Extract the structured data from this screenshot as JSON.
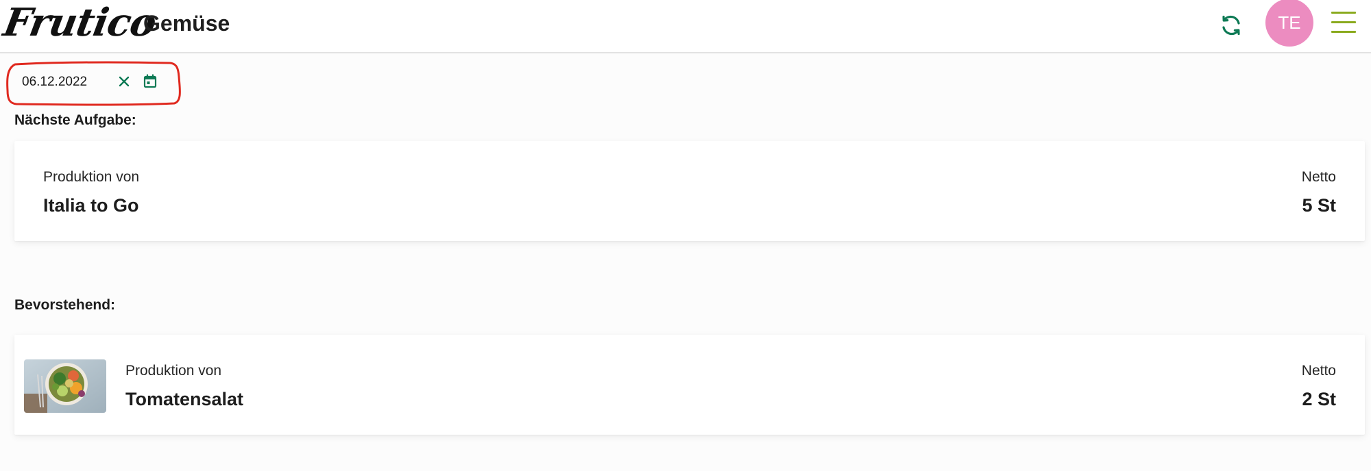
{
  "header": {
    "logo_text": "Frutico",
    "title": "Gemüse",
    "refresh_icon": "refresh-icon",
    "avatar_initials": "TE",
    "menu_icon": "hamburger-menu-icon",
    "colors": {
      "accent": "#0e7a55",
      "avatar": "#ec8cc0",
      "menu": "#8aaa1e"
    }
  },
  "date_filter": {
    "value": "06.12.2022",
    "clear_icon": "close-icon",
    "calendar_icon": "calendar-icon",
    "highlight_color": "#e0291f"
  },
  "next_task": {
    "heading": "Nächste Aufgabe:",
    "card": {
      "label": "Produktion von",
      "title": "Italia to Go",
      "right_label": "Netto",
      "right_value": "5 St"
    }
  },
  "upcoming": {
    "heading": "Bevorstehend:",
    "items": [
      {
        "label": "Produktion von",
        "title": "Tomatensalat",
        "right_label": "Netto",
        "right_value": "2 St",
        "image": "salad-bowl-image"
      }
    ]
  }
}
